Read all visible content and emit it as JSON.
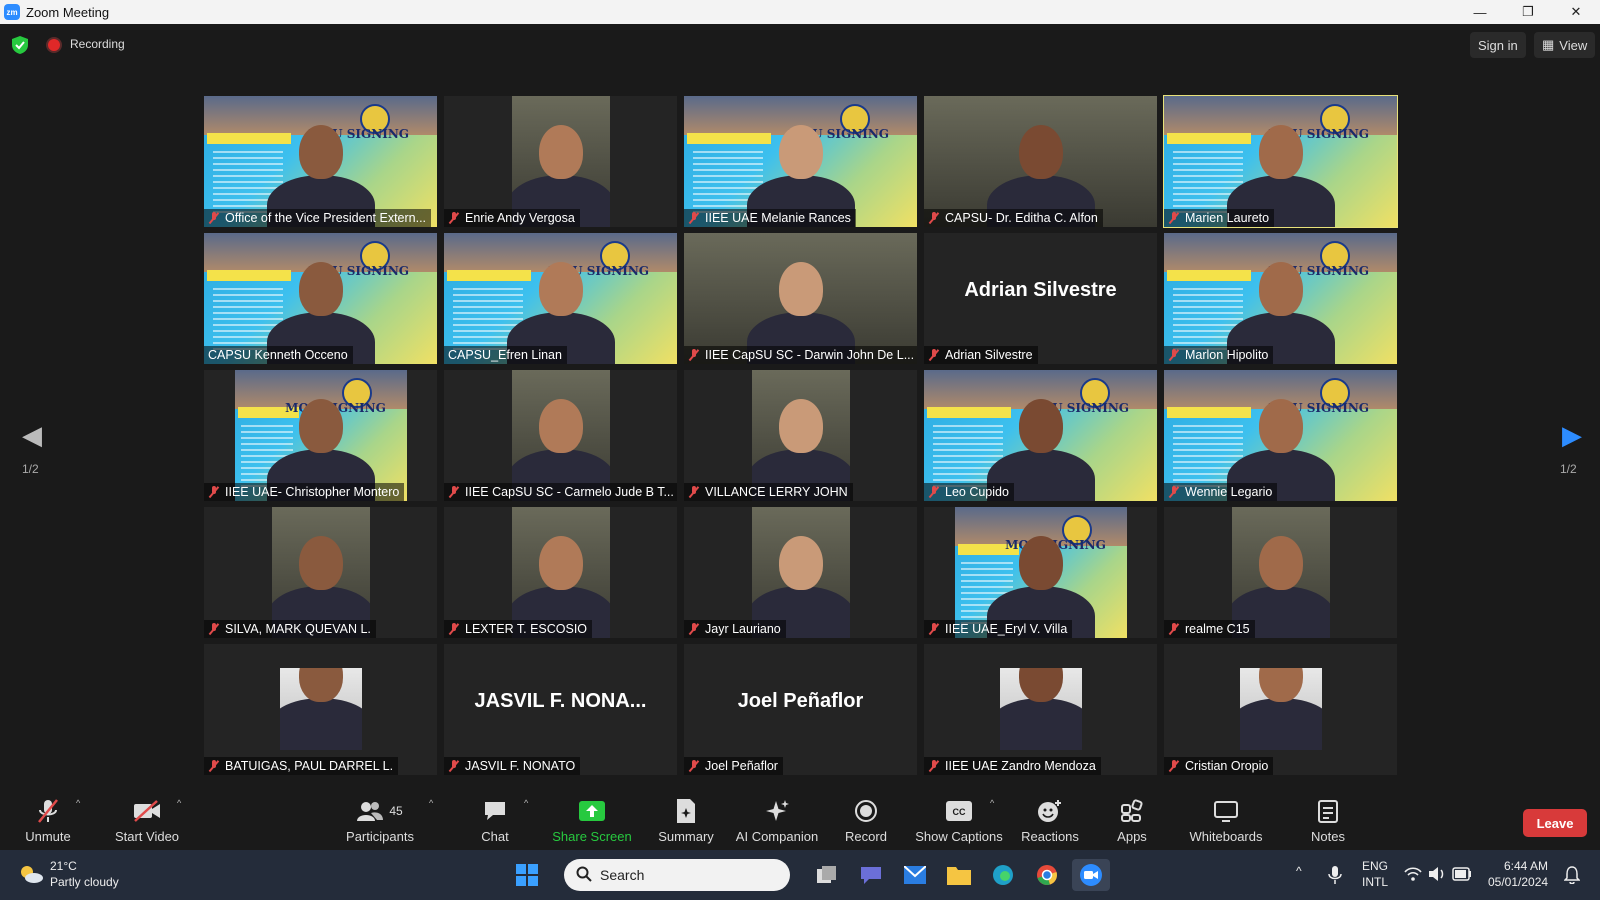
{
  "window": {
    "title": "Zoom Meeting",
    "app_icon": "zm",
    "minimize": "—",
    "restore": "❐",
    "close": "✕"
  },
  "topbar": {
    "recording_label": "Recording",
    "signin_label": "Sign in",
    "view_label": "View"
  },
  "gallery": {
    "page_label_left": "1/2",
    "page_label_right": "1/2",
    "tiles": [
      {
        "name": "Office of the Vice President Extern...",
        "type": "poster"
      },
      {
        "name": "Enrie Andy Vergosa",
        "type": "small"
      },
      {
        "name": "IIEE UAE Melanie Rances",
        "type": "poster"
      },
      {
        "name": "CAPSU- Dr. Editha C. Alfon",
        "type": "room"
      },
      {
        "name": "Marien Laureto",
        "type": "poster",
        "active": true
      },
      {
        "name": "CAPSU Kenneth Occeno",
        "type": "poster",
        "mic_on": true
      },
      {
        "name": "CAPSU_Efren Linan",
        "type": "poster",
        "mic_on": true
      },
      {
        "name": "IIEE CapSU SC - Darwin John De L...",
        "type": "room"
      },
      {
        "name": "Adrian Silvestre",
        "type": "name",
        "big": "Adrian Silvestre"
      },
      {
        "name": "Marlon Hipolito",
        "type": "poster"
      },
      {
        "name": "IIEE UAE- Christopher Montero",
        "type": "poster-small"
      },
      {
        "name": "IIEE CapSU SC - Carmelo Jude B T...",
        "type": "small"
      },
      {
        "name": "VILLANCE LERRY JOHN",
        "type": "small"
      },
      {
        "name": "Leo Cupido",
        "type": "poster"
      },
      {
        "name": "Wennie Legario",
        "type": "poster"
      },
      {
        "name": "SILVA, MARK QUEVAN L.",
        "type": "small"
      },
      {
        "name": "LEXTER T. ESCOSIO",
        "type": "small"
      },
      {
        "name": "Jayr Lauriano",
        "type": "small"
      },
      {
        "name": "IIEE UAE_Eryl V. Villa",
        "type": "poster-small"
      },
      {
        "name": "realme C15",
        "type": "small"
      },
      {
        "name": "BATUIGAS, PAUL DARREL L.",
        "type": "photo"
      },
      {
        "name": "JASVIL F. NONATO",
        "type": "name",
        "big": "JASVIL F. NONA..."
      },
      {
        "name": "Joel Peñaflor",
        "type": "name",
        "big": "Joel Peñaflor"
      },
      {
        "name": "IIEE UAE Zandro Mendoza",
        "type": "photo"
      },
      {
        "name": "Cristian Oropio",
        "type": "photo"
      }
    ],
    "poster_title": "MOU SIGNING"
  },
  "toolbar": {
    "unmute": "Unmute",
    "start_video": "Start Video",
    "participants": "Participants",
    "participants_count": "45",
    "chat": "Chat",
    "share_screen": "Share Screen",
    "summary": "Summary",
    "ai_companion": "AI Companion",
    "record": "Record",
    "show_captions": "Show Captions",
    "reactions": "Reactions",
    "apps": "Apps",
    "whiteboards": "Whiteboards",
    "notes": "Notes",
    "leave": "Leave"
  },
  "taskbar": {
    "temperature": "21°C",
    "weather": "Partly cloudy",
    "search_placeholder": "Search",
    "lang_top": "ENG",
    "lang_bottom": "INTL",
    "time": "6:44 AM",
    "date": "05/01/2024"
  },
  "colors": {
    "accent": "#2d8cff",
    "leave": "#d83a3a",
    "share": "#27c93f",
    "active_speaker": "#e8e27a"
  }
}
